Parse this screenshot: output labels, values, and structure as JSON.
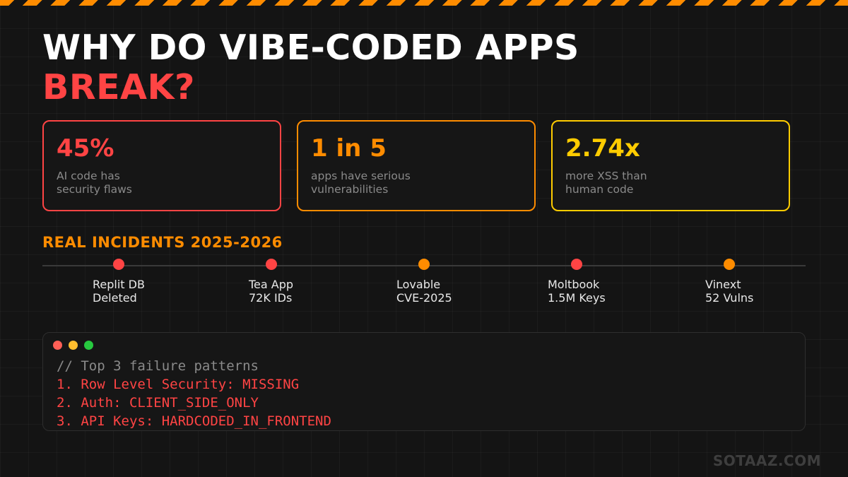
{
  "title": {
    "line1": "WHY DO VIBE-CODED APPS",
    "line2": "BREAK?"
  },
  "stats": [
    {
      "value": "45%",
      "line1": "AI code has",
      "line2": "security flaws",
      "color": "#ff4444"
    },
    {
      "value": "1 in 5",
      "line1": "apps have serious",
      "line2": "vulnerabilities",
      "color": "#ff8c00"
    },
    {
      "value": "2.74x",
      "line1": "more XSS than",
      "line2": "human code",
      "color": "#ffcc00"
    }
  ],
  "incidents": {
    "heading": "REAL INCIDENTS 2025-2026",
    "items": [
      {
        "line1": "Replit DB",
        "line2": "Deleted",
        "color": "#ff4444"
      },
      {
        "line1": "Tea App",
        "line2": "72K IDs",
        "color": "#ff4444"
      },
      {
        "line1": "Lovable",
        "line2": "CVE-2025",
        "color": "#ff8c00"
      },
      {
        "line1": "Moltbook",
        "line2": "1.5M Keys",
        "color": "#ff4444"
      },
      {
        "line1": "Vinext",
        "line2": "52 Vulns",
        "color": "#ff8c00"
      }
    ]
  },
  "terminal": {
    "comment": "// Top 3 failure patterns",
    "lines": [
      "1. Row Level Security: MISSING",
      "2. Auth: CLIENT_SIDE_ONLY",
      "3. API Keys: HARDCODED_IN_FRONTEND"
    ]
  },
  "brand": "SOTAAZ.COM"
}
